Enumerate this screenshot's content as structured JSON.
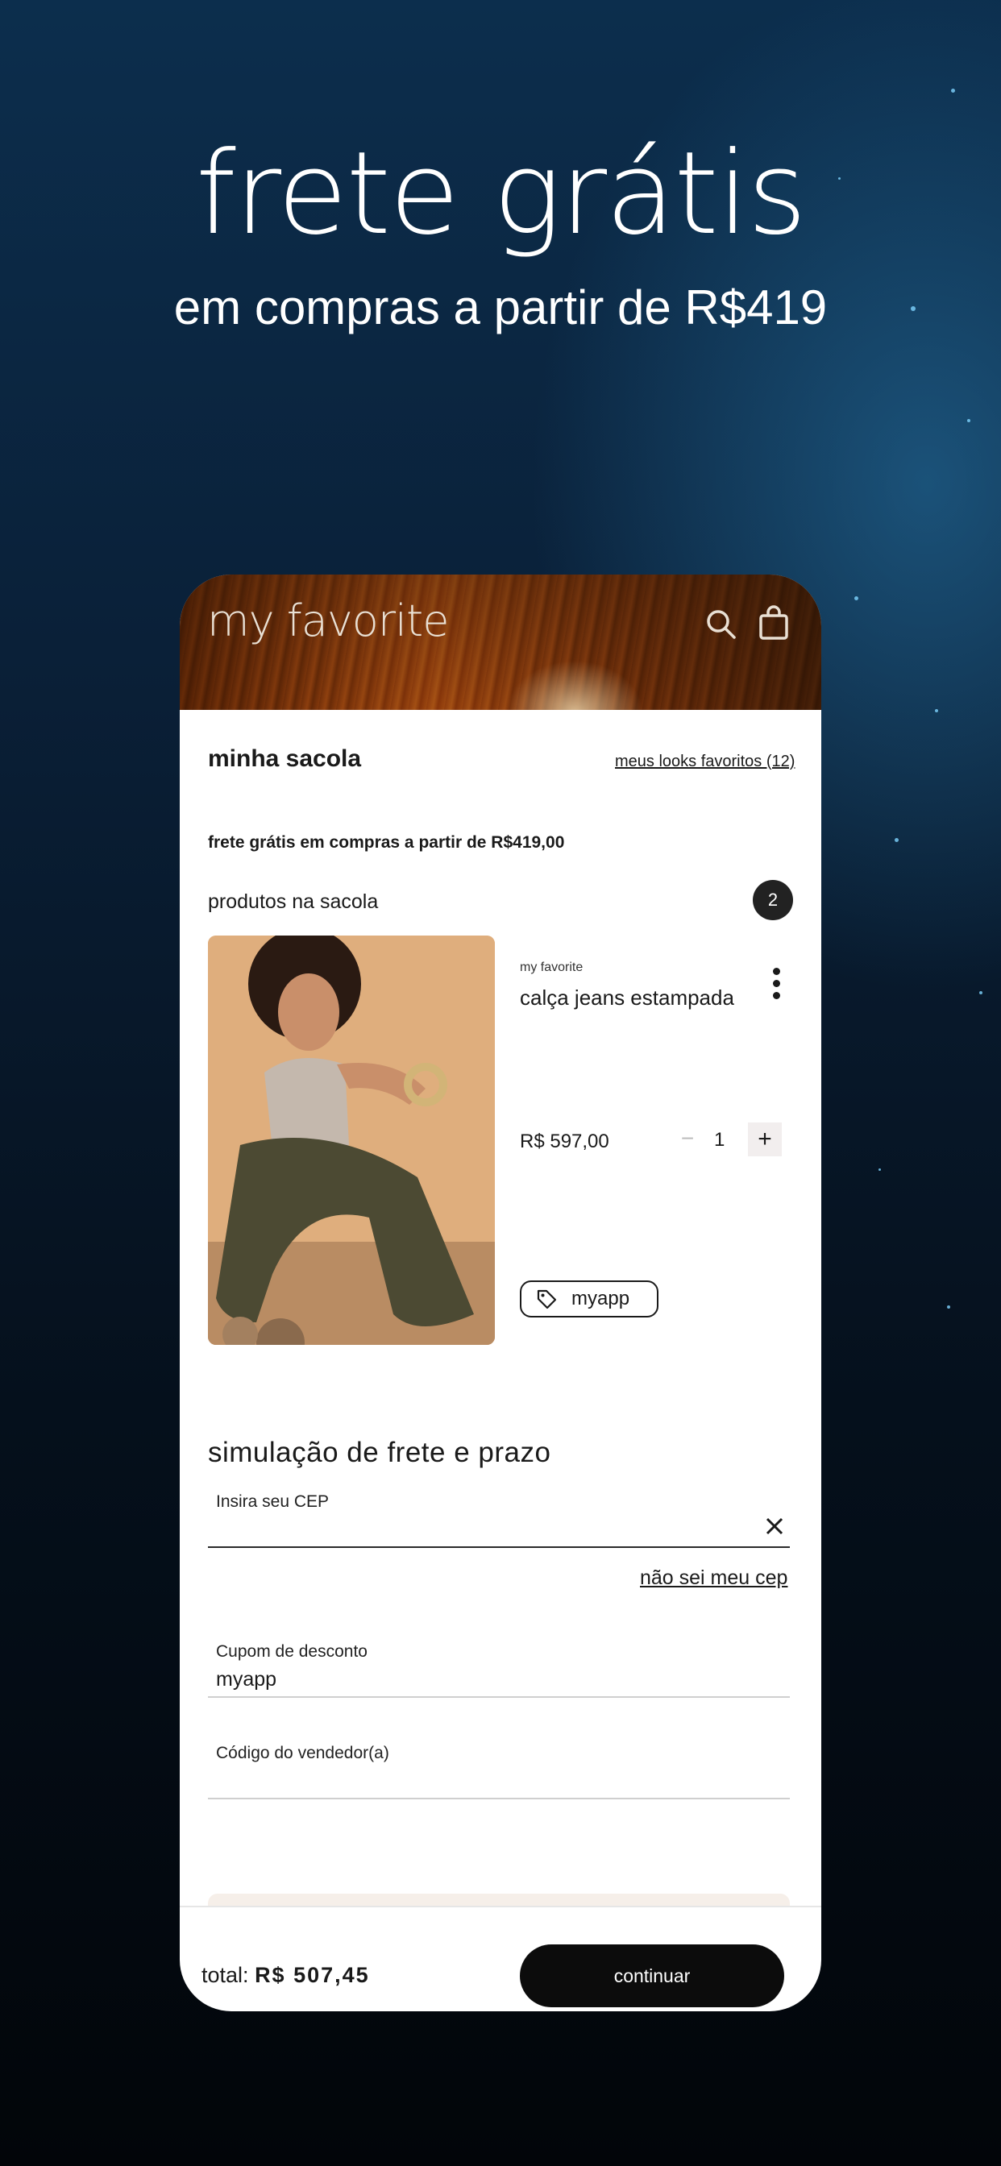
{
  "hero": {
    "title": "frete grátis",
    "subtitle": "em compras a partir de R$419"
  },
  "app": {
    "logo": "my favorite",
    "header_icons": [
      "search-icon",
      "bag-icon"
    ]
  },
  "bag": {
    "title": "minha sacola",
    "favorites_link": "meus looks favoritos (12)",
    "free_shipping_note": "frete grátis em compras a partir de R$419,00",
    "products_label": "produtos na sacola",
    "products_count": "2"
  },
  "product": {
    "brand": "my favorite",
    "name": "calça jeans estampada",
    "price": "R$ 597,00",
    "quantity": "1",
    "coupon_tag": "myapp"
  },
  "shipping": {
    "title": "simulação de frete e prazo",
    "cep_label": "Insira seu CEP",
    "cep_value": "",
    "cep_link": "não sei meu cep"
  },
  "discount": {
    "label": "Cupom de desconto",
    "value": "myapp"
  },
  "seller": {
    "label": "Código do vendedor(a)",
    "value": ""
  },
  "footer": {
    "total_label": "total:",
    "total_value": "R$ 507,45",
    "continue_label": "continuar"
  }
}
